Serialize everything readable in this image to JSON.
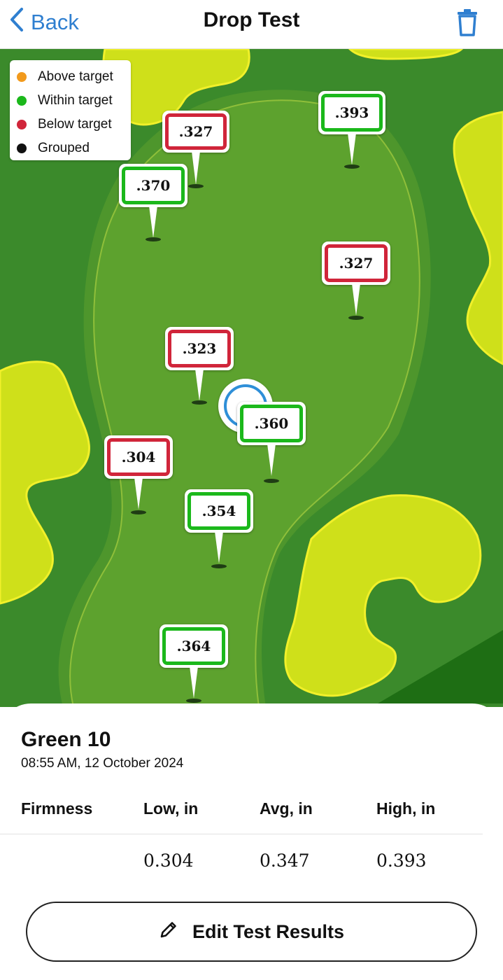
{
  "header": {
    "back_label": "Back",
    "title": "Drop Test"
  },
  "legend": [
    {
      "label": "Above target",
      "color": "#f29a1c"
    },
    {
      "label": "Within target",
      "color": "#1bb81b"
    },
    {
      "label": "Below target",
      "color": "#d0253a"
    },
    {
      "label": "Grouped",
      "color": "#111111"
    }
  ],
  "colors": {
    "within": "#1bb81b",
    "below": "#d0253a",
    "accent": "#2f7fd0",
    "fairway": "#3b8a2b",
    "green": "#5da22e",
    "bunker": "#cfe01a"
  },
  "pins": [
    {
      "value": ".327",
      "status": "below"
    },
    {
      "value": ".393",
      "status": "within"
    },
    {
      "value": ".370",
      "status": "within"
    },
    {
      "value": ".327",
      "status": "below"
    },
    {
      "value": ".323",
      "status": "below"
    },
    {
      "value": ".360",
      "status": "within"
    },
    {
      "value": ".304",
      "status": "below"
    },
    {
      "value": ".354",
      "status": "within"
    },
    {
      "value": ".364",
      "status": "within"
    }
  ],
  "summary": {
    "green_name": "Green 10",
    "timestamp": "08:55 AM, 12 October 2024",
    "columns": [
      "Firmness",
      "Low, in",
      "Avg, in",
      "High, in"
    ],
    "values": {
      "low": "0.304",
      "avg": "0.347",
      "high": "0.393"
    },
    "edit_label": "Edit Test Results"
  }
}
